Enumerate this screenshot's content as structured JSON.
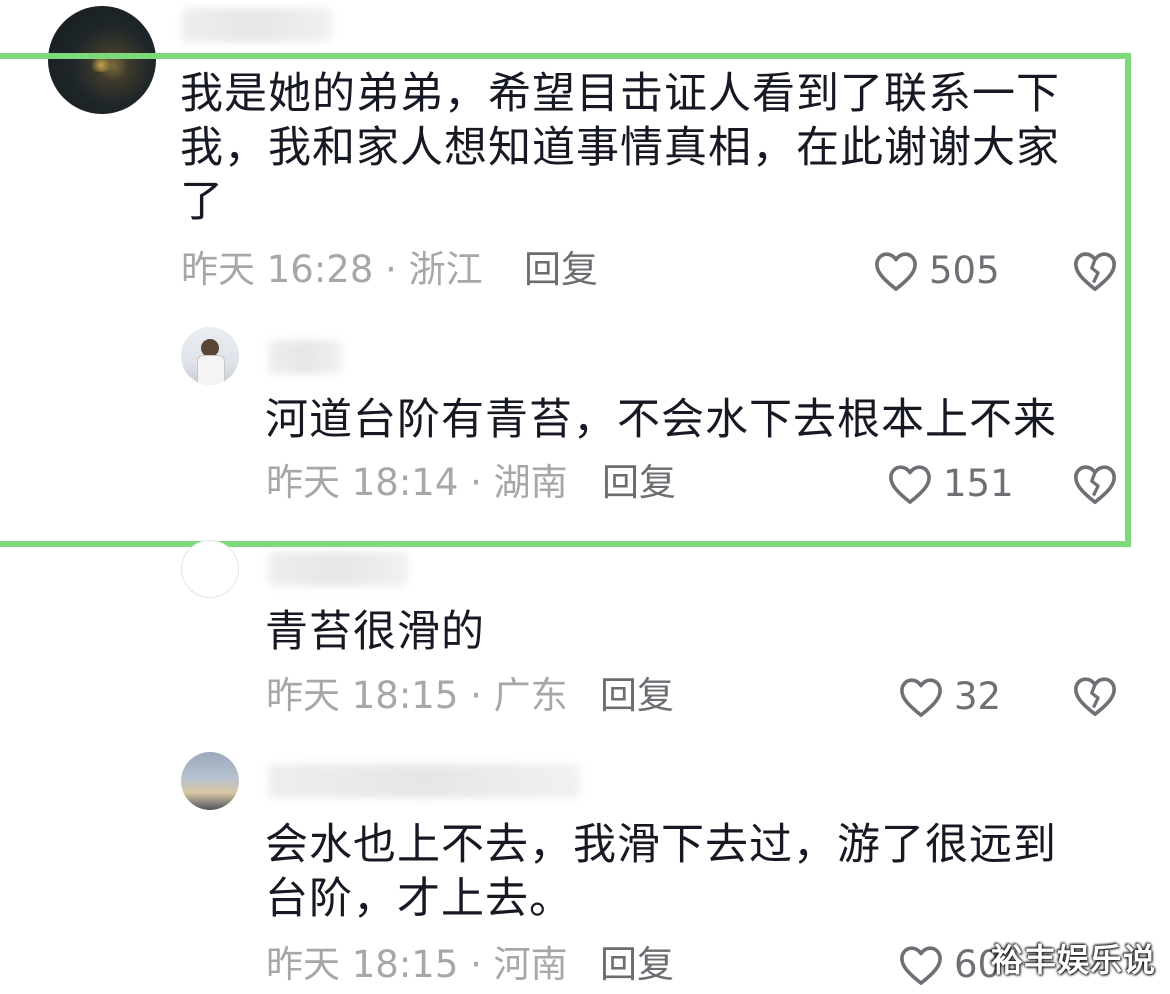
{
  "comments": [
    {
      "text": "我是她的弟弟，希望目击证人看到了联系一下\n我，我和家人想知道事情真相，在此谢谢大家\n了",
      "meta": "昨天 16:28 · 浙江",
      "reply_label": "回复",
      "like_count": "505"
    },
    {
      "text": "河道台阶有青苔，不会水下去根本上不来",
      "meta": "昨天 18:14 · 湖南",
      "reply_label": "回复",
      "like_count": "151"
    },
    {
      "text": "青苔很滑的",
      "meta": "昨天 18:15 · 广东",
      "reply_label": "回复",
      "like_count": "32"
    },
    {
      "text": "会水也上不去，我滑下去过，游了很远到\n台阶，才上去。",
      "meta": "昨天 18:15 · 河南",
      "reply_label": "回复",
      "like_count": "60"
    }
  ],
  "watermark": "裕丰娱乐说",
  "colors": {
    "highlight_border": "#7ed97a",
    "text_primary": "#161823",
    "text_meta": "#a7a7ab",
    "icon": "#6f6f75"
  },
  "icons": {
    "like": "heart-outline-icon",
    "dislike": "broken-heart-icon"
  }
}
